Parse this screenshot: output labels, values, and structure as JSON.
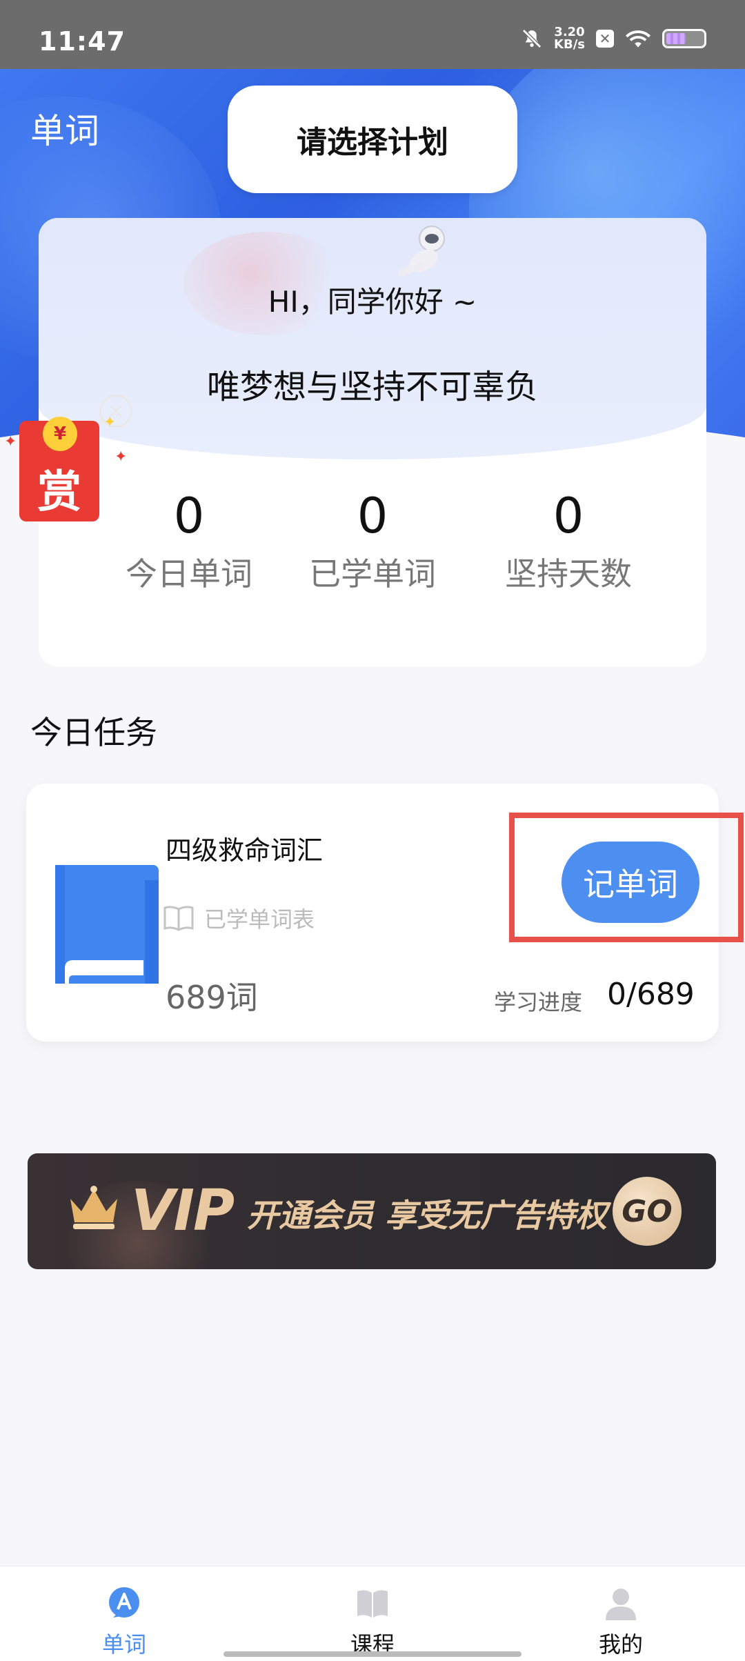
{
  "status_bar": {
    "time": "11:47",
    "net_speed_value": "3.20",
    "net_speed_unit": "KB/s",
    "icons": [
      "mute-icon",
      "x-badge-icon",
      "wifi-icon",
      "battery-icon"
    ]
  },
  "header": {
    "title": "单词",
    "plan_button": "请选择计划"
  },
  "greeting": {
    "hi": "HI，同学你好 ~",
    "motto": "唯梦想与坚持不可辜负"
  },
  "stats": [
    {
      "value": "0",
      "label": "今日单词"
    },
    {
      "value": "0",
      "label": "已学单词"
    },
    {
      "value": "0",
      "label": "坚持天数"
    }
  ],
  "reward": {
    "label": "赏",
    "coin": "¥",
    "close": "×"
  },
  "tasks": {
    "section_title": "今日任务",
    "book_name": "四级救命词汇",
    "wordlist_link": "已学单词表",
    "word_count": "689词",
    "progress_label": "学习进度",
    "progress_value": "0/689",
    "action_button": "记单词"
  },
  "vip_banner": {
    "vip_word": "VIP",
    "text": "开通会员 享受无广告特权",
    "go": "GO"
  },
  "bottom_nav": {
    "items": [
      {
        "label": "单词",
        "icon": "word-tab-icon",
        "active": true
      },
      {
        "label": "课程",
        "icon": "book-open-icon",
        "active": false
      },
      {
        "label": "我的",
        "icon": "person-icon",
        "active": false
      }
    ]
  },
  "colors": {
    "accent": "#4d8ff0",
    "hero_blue": "#3f78f0",
    "highlight_red": "#e8514a",
    "vip_gold": "#e9c9a2"
  }
}
